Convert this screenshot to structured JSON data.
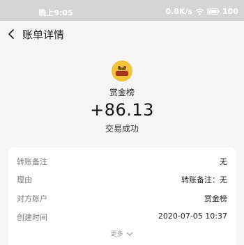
{
  "status_bar": {
    "time": "晚上9:05",
    "net_speed": "0.8K/s",
    "battery": "100"
  },
  "header": {
    "title": "账单详情"
  },
  "merchant": {
    "name": "赏金榜",
    "avatar_text": "赏金榜"
  },
  "transaction": {
    "amount": "+86.13",
    "status": "交易成功"
  },
  "details": {
    "rows": [
      {
        "label": "转账备注",
        "value": "无"
      },
      {
        "label": "理由",
        "value": "转账备注：无"
      },
      {
        "label": "对方账户",
        "value": "赏金榜"
      },
      {
        "label": "创建时间",
        "value": "2020-07-05 10:37"
      }
    ],
    "more_label": "更多"
  },
  "colors": {
    "avatar_bg": "#f3c23a",
    "page_bg": "#f5f5f5",
    "status_bar_bg": "#d5d5d5"
  },
  "icons": [
    "back-arrow-icon",
    "wifi-icon",
    "battery-icon",
    "chevron-down-icon"
  ]
}
